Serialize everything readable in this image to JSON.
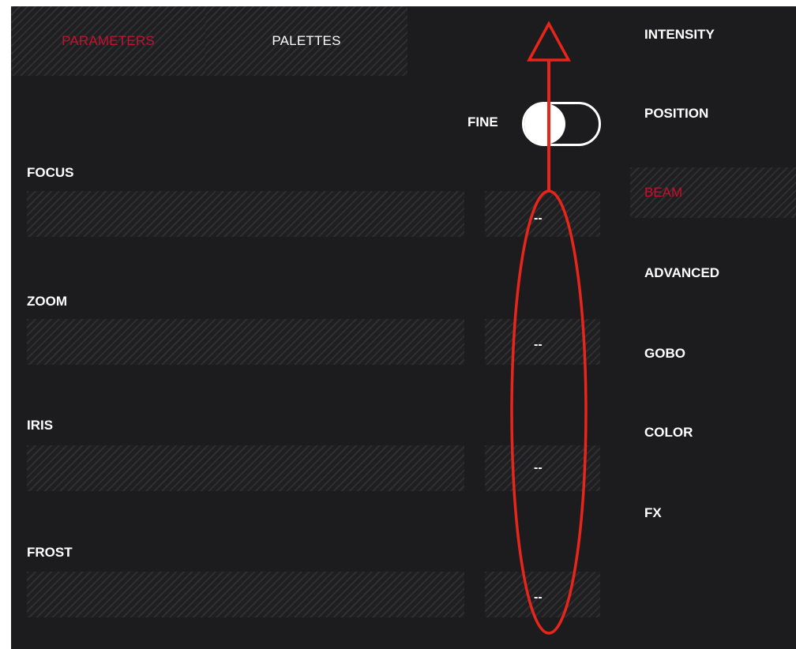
{
  "tabs": {
    "parameters": "PARAMETERS",
    "palettes": "PALETTES"
  },
  "fine_toggle": {
    "label": "FINE",
    "state": "on"
  },
  "parameters": [
    {
      "label": "FOCUS",
      "value": "--"
    },
    {
      "label": "ZOOM",
      "value": "--"
    },
    {
      "label": "IRIS",
      "value": "--"
    },
    {
      "label": "FROST",
      "value": "--"
    }
  ],
  "categories": [
    {
      "label": "INTENSITY",
      "active": false
    },
    {
      "label": "POSITION",
      "active": false
    },
    {
      "label": "BEAM",
      "active": true
    },
    {
      "label": "ADVANCED",
      "active": false
    },
    {
      "label": "GOBO",
      "active": false
    },
    {
      "label": "COLOR",
      "active": false
    },
    {
      "label": "FX",
      "active": false
    }
  ],
  "colors": {
    "accent": "#c8102e",
    "background": "#1c1c1e",
    "annotation": "#e8251a"
  }
}
